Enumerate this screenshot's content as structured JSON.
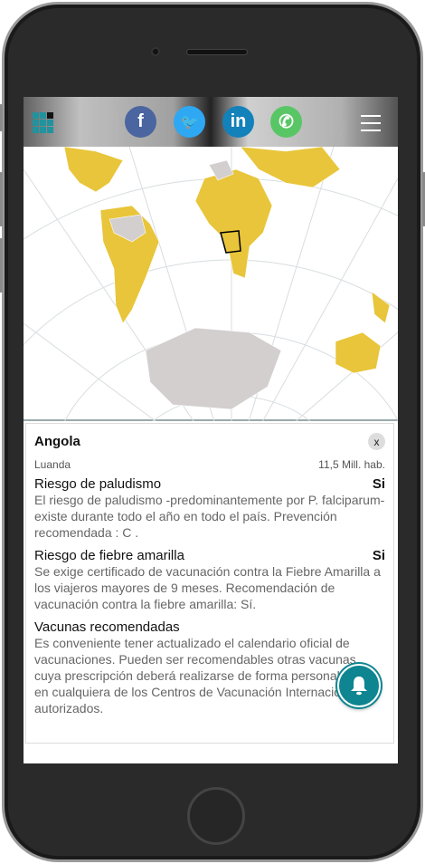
{
  "header": {
    "logo": "site-logo",
    "social": [
      {
        "name": "facebook",
        "glyph": "f",
        "color": "#3b5998"
      },
      {
        "name": "twitter",
        "glyph": "🐦",
        "color": "#1da1f2"
      },
      {
        "name": "linkedin",
        "glyph": "in",
        "color": "#0077b5"
      },
      {
        "name": "whatsapp",
        "glyph": "✆",
        "color": "#4cc25a"
      }
    ]
  },
  "country": {
    "name": "Angola",
    "close": "x",
    "capital": "Luanda",
    "population": "11,5 Mill. hab.",
    "malaria": {
      "title": "Riesgo de paludismo",
      "value": "Si",
      "text": "El riesgo de paludismo -predominantemente por P. falciparum- existe durante todo el año en todo el país. Prevención recomendada : C ."
    },
    "yellow_fever": {
      "title": "Riesgo de fiebre amarilla",
      "value": "Si",
      "text": "Se exige certificado de vacunación contra la Fiebre Amarilla a los viajeros mayores de 9 meses. Recomendación de vacunación contra la fiebre amarilla: Sí."
    },
    "vaccines": {
      "title": "Vacunas recomendadas",
      "text": "Es conveniente tener actualizado el calendario oficial de vacunaciones. Pueden ser recomendables otras vacunas, cuya prescripción deberá realizarse de forma personalizada en cualquiera de los Centros de Vacunación Internacional autorizados."
    }
  },
  "colors": {
    "risk": "#e8c53a",
    "no_risk": "#d3cfcf",
    "accent": "#0e8590"
  }
}
